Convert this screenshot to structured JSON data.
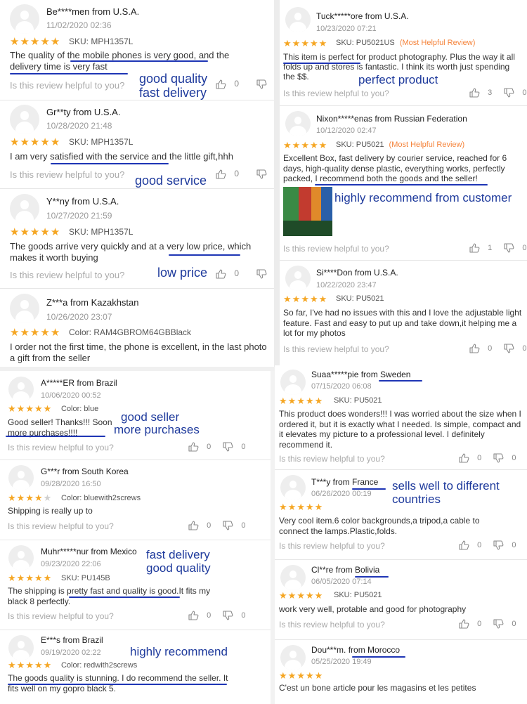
{
  "left_top": [
    {
      "name": "Be****men from  U.S.A.",
      "date": "11/02/2020 02:36",
      "stars": 5,
      "sku": "SKU: MPH1357L",
      "text": "The quality of the mobile phones is very good, and the delivery time is very fast",
      "helpful": "Is this review helpful to you?",
      "up": "0",
      "down": "0",
      "note": [
        "good quality",
        "fast delivery"
      ]
    },
    {
      "name": "Gr**ty from  U.S.A.",
      "date": "10/28/2020 21:48",
      "stars": 5,
      "sku": "SKU: MPH1357L",
      "text": "I am very satisfied with the service and the little gift,hhh",
      "helpful": "Is this review helpful to you?",
      "up": "0",
      "down": "0",
      "note": [
        "good service"
      ]
    },
    {
      "name": "Y**ny from  U.S.A.",
      "date": "10/27/2020 21:59",
      "stars": 5,
      "sku": "SKU: MPH1357L",
      "text": "The goods arrive very quickly and at a very low price, which makes it worth buying",
      "helpful": "Is this review helpful to you?",
      "up": "0",
      "down": "0",
      "note": [
        "low price"
      ]
    },
    {
      "name": "Z***a from Kazakhstan",
      "date": "10/26/2020 23:07",
      "stars": 5,
      "sku": "Color: RAM4GBROM64GBBlack",
      "text": "I order not the first time, the phone is excellent, in the last photo a gift from the seller"
    }
  ],
  "right_top": [
    {
      "name": "Tuck*****ore from  U.S.A.",
      "date": "10/23/2020 07:21",
      "stars": 5,
      "sku": "SKU: PU5021US",
      "tag": "(Most Helpful Review)",
      "text": "This item is perfect for product photography. Plus the way it all folds up and stores is fantastic. I think its worth just spending the $$.",
      "helpful": "Is this review helpful to you?",
      "up": "3",
      "down": "0",
      "note": [
        "perfect product"
      ]
    },
    {
      "name": "Nixon*****enas from  Russian Federation",
      "date": "10/12/2020 02:47",
      "stars": 5,
      "sku": "SKU: PU5021",
      "tag": "(Most Helpful Review)",
      "text": "Excellent Box, fast delivery by courier service, reached for 6 days, high-quality dense plastic, everything works, perfectly packed, I recommend both the goods and the seller!",
      "helpful": "Is this review helpful to you?",
      "up": "1",
      "down": "0",
      "note": [
        "highly recommend from customer"
      ]
    },
    {
      "name": "Si****Don from  U.S.A.",
      "date": "10/22/2020 23:47",
      "stars": 5,
      "sku": "SKU: PU5021",
      "text": "So far, I've had no issues with this and I love the adjustable light feature. Fast and easy to put up and take down,it helping me a lot for my photos",
      "helpful": "Is this review helpful to you?",
      "up": "0",
      "down": "0"
    }
  ],
  "left_bottom": [
    {
      "name": "A*****ER from Brazil",
      "date": "10/06/2020 00:52",
      "stars": 5,
      "sku": "Color: blue",
      "text": "Good seller! Thanks!!! Soon more purchases!!!!",
      "helpful": "Is this review helpful to you?",
      "up": "0",
      "down": "0",
      "note": [
        "good seller",
        "more purchases"
      ]
    },
    {
      "name": "G***r from South Korea",
      "date": "09/28/2020 16:50",
      "stars": 4,
      "sku": "Color: bluewith2screws",
      "text": "Shipping is really up to",
      "helpful": "Is this review helpful to you?",
      "up": "0",
      "down": "0"
    },
    {
      "name": "Muhr*****nur from  Mexico",
      "date": "09/23/2020 22:06",
      "stars": 5,
      "sku": "SKU: PU145B",
      "text": "The shipping is pretty fast and quality is good.It fits my black 8 perfectly.",
      "helpful": "Is this review helpful to you?",
      "up": "0",
      "down": "0",
      "note": [
        "fast delivery",
        "good quality"
      ]
    },
    {
      "name": "E***s from Brazil",
      "date": "09/19/2020 02:22",
      "stars": 5,
      "sku": "Color: redwith2screws",
      "text": "The goods quality is stunning. I do recommend the seller. It fits well on my gopro black 5.",
      "note": [
        "highly recommend"
      ]
    }
  ],
  "right_bottom": [
    {
      "name": "Suaa*****pie from  Sweden",
      "date": "07/15/2020 06:08",
      "stars": 5,
      "sku": "SKU: PU5021",
      "text": "This product does wonders!!! I was worried about the size when I ordered it, but it is exactly what I needed. Is simple, compact and it elevates my picture to a professional level. I definitely recommend it.",
      "helpful": "Is this review helpful to you?",
      "up": "0",
      "down": "0"
    },
    {
      "name": "T***y from France",
      "date": "06/26/2020 00:19",
      "stars": 5,
      "text": "Very cool item.6 color backgrounds,a tripod,a cable to connect the lamps.Plastic,folds.",
      "helpful": "Is this review helpful to you?",
      "up": "0",
      "down": "0",
      "note": [
        "sells well to different",
        "countries"
      ]
    },
    {
      "name": "Cl**re from  Bolivia",
      "date": "06/05/2020 07:14",
      "stars": 5,
      "sku": "SKU: PU5021",
      "text": "work very well, protable and good for photography",
      "helpful": "Is this review helpful to you?",
      "up": "0",
      "down": "0"
    },
    {
      "name": "Dou***m. from Morocco",
      "date": "05/25/2020 19:49",
      "stars": 5,
      "text": "C'est un bone article pour les magasins et les petites"
    }
  ],
  "colors": {
    "stars": "#f5a623",
    "note": "#1e3a9c",
    "underline": "#1e35b5",
    "tag": "#f5833a"
  }
}
